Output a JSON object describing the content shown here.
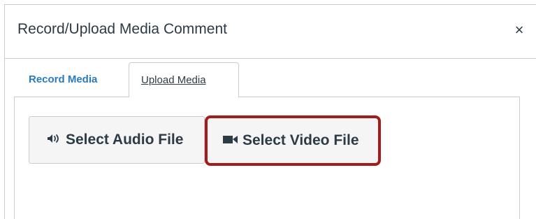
{
  "dialog": {
    "title": "Record/Upload Media Comment",
    "close_label": "×"
  },
  "tabs": [
    {
      "label": "Record Media",
      "active": false
    },
    {
      "label": "Upload Media",
      "active": true
    }
  ],
  "upload_panel": {
    "audio_button_label": "Select Audio File",
    "audio_icon": "speaker-icon",
    "video_button_label": "Select Video File",
    "video_icon": "video-camera-icon"
  },
  "colors": {
    "link": "#2b7abc",
    "text": "#2d3b45",
    "highlight_border": "#a31c1c",
    "button_bg": "#f5f5f5",
    "border": "#c7cdd1"
  }
}
